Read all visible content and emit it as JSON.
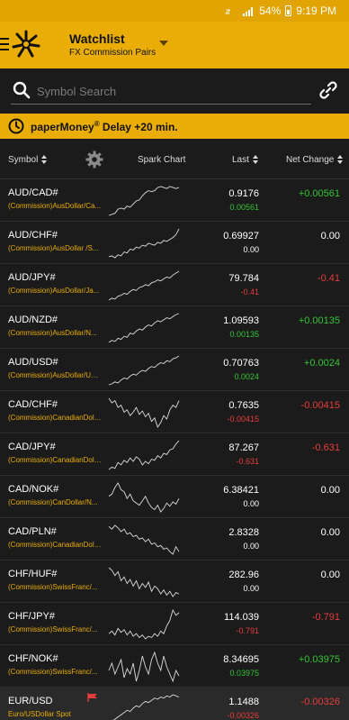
{
  "status_bar": {
    "battery": "54%",
    "time": "9:19 PM"
  },
  "header": {
    "title": "Watchlist",
    "subtitle": "FX Commission Pairs"
  },
  "search": {
    "placeholder": "Symbol Search"
  },
  "banner": {
    "brand": "paperMoney",
    "reg": "®",
    "text": " Delay +20 min."
  },
  "columns": {
    "symbol": "Symbol",
    "spark": "Spark Chart",
    "last": "Last",
    "net_change": "Net Change"
  },
  "colors": {
    "accent": "#e9ad06",
    "positive": "#35c435",
    "negative": "#e83c3c"
  },
  "rows": [
    {
      "symbol": "AUD/CAD#",
      "desc": "(Commission)AusDollar/Ca...",
      "last": "0.9176",
      "chg": "0.00561",
      "net": "+0.00561",
      "dir": "pos",
      "spark": [
        3,
        4,
        5,
        9,
        10,
        9,
        12,
        11,
        14,
        17,
        18,
        22,
        25,
        27,
        26,
        27,
        30,
        31,
        30,
        29,
        31,
        30,
        29,
        30
      ]
    },
    {
      "symbol": "AUD/CHF#",
      "desc": "(Commission)AusDollar /S...",
      "last": "0.69927",
      "chg": "0.00",
      "net": "0.00",
      "dir": "zero",
      "spark": [
        4,
        5,
        3,
        6,
        5,
        9,
        8,
        12,
        11,
        14,
        13,
        16,
        15,
        18,
        17,
        16,
        19,
        18,
        21,
        20,
        22,
        24,
        27,
        33
      ]
    },
    {
      "symbol": "AUD/JPY#",
      "desc": "(Commission)AusDollar/Ja...",
      "last": "79.784",
      "chg": "-0.41",
      "net": "-0.41",
      "dir": "neg",
      "spark": [
        3,
        5,
        4,
        7,
        8,
        10,
        9,
        12,
        14,
        13,
        16,
        17,
        19,
        18,
        21,
        22,
        24,
        23,
        25,
        27,
        26,
        29,
        31,
        33
      ]
    },
    {
      "symbol": "AUD/NZD#",
      "desc": "(Commission)AusDollar/N...",
      "last": "1.09593",
      "chg": "0.00135",
      "net": "+0.00135",
      "dir": "pos",
      "spark": [
        4,
        6,
        5,
        8,
        7,
        10,
        9,
        13,
        12,
        15,
        17,
        16,
        19,
        21,
        20,
        23,
        25,
        24,
        26,
        28,
        27,
        29,
        31,
        32
      ]
    },
    {
      "symbol": "AUD/USD#",
      "desc": "(Commission)AusDollar/US...",
      "last": "0.70763",
      "chg": "0.0024",
      "net": "+0.0024",
      "dir": "pos",
      "spark": [
        3,
        4,
        6,
        5,
        8,
        10,
        9,
        12,
        14,
        13,
        16,
        18,
        17,
        20,
        22,
        21,
        24,
        26,
        25,
        28,
        27,
        30,
        31,
        33
      ]
    },
    {
      "symbol": "CAD/CHF#",
      "desc": "(Commission)CanadianDoll...",
      "last": "0.7635",
      "chg": "-0.00415",
      "net": "-0.00415",
      "dir": "neg",
      "spark": [
        30,
        26,
        28,
        22,
        24,
        18,
        20,
        15,
        18,
        22,
        16,
        19,
        14,
        17,
        10,
        13,
        5,
        9,
        15,
        12,
        20,
        24,
        22,
        28
      ]
    },
    {
      "symbol": "CAD/JPY#",
      "desc": "(Commission)CanadianDoll...",
      "last": "87.267",
      "chg": "-0.631",
      "net": "-0.631",
      "dir": "neg",
      "spark": [
        8,
        10,
        9,
        14,
        12,
        16,
        14,
        18,
        15,
        19,
        17,
        12,
        15,
        13,
        17,
        16,
        20,
        18,
        22,
        21,
        25,
        26,
        30,
        33
      ]
    },
    {
      "symbol": "CAD/NOK#",
      "desc": "(Commission)CanDollar/N...",
      "last": "6.38421",
      "chg": "0.00",
      "net": "0.00",
      "dir": "zero",
      "spark": [
        20,
        22,
        28,
        32,
        26,
        24,
        18,
        22,
        16,
        14,
        12,
        16,
        20,
        14,
        10,
        8,
        12,
        6,
        9,
        14,
        11,
        15,
        13,
        18
      ]
    },
    {
      "symbol": "CAD/PLN#",
      "desc": "(Commission)CanadianDoll...",
      "last": "2.8328",
      "chg": "0.00",
      "net": "0.00",
      "dir": "zero",
      "spark": [
        26,
        24,
        27,
        25,
        22,
        24,
        20,
        21,
        18,
        19,
        16,
        17,
        14,
        16,
        12,
        13,
        10,
        11,
        8,
        9,
        6,
        4,
        10,
        6
      ]
    },
    {
      "symbol": "CHF/HUF#",
      "desc": "(Commission)SwissFranc/...",
      "last": "282.96",
      "chg": "0.00",
      "net": "0.00",
      "dir": "zero",
      "spark": [
        30,
        28,
        24,
        27,
        20,
        23,
        18,
        21,
        16,
        20,
        14,
        18,
        15,
        19,
        12,
        16,
        14,
        10,
        13,
        9,
        12,
        8,
        11,
        10
      ]
    },
    {
      "symbol": "CHF/JPY#",
      "desc": "(Commission)SwissFranc/...",
      "last": "114.039",
      "chg": "-0.791",
      "net": "-0.791",
      "dir": "neg",
      "spark": [
        10,
        12,
        9,
        14,
        11,
        13,
        9,
        12,
        8,
        10,
        7,
        9,
        6,
        8,
        7,
        10,
        8,
        12,
        10,
        16,
        20,
        28,
        24,
        26
      ]
    },
    {
      "symbol": "CHF/NOK#",
      "desc": "(Commission)SwissFranc/...",
      "last": "8.34695",
      "chg": "0.03975",
      "net": "+0.03975",
      "dir": "pos",
      "spark": [
        20,
        24,
        18,
        22,
        26,
        16,
        21,
        18,
        24,
        14,
        20,
        28,
        22,
        18,
        26,
        30,
        24,
        20,
        28,
        22,
        18,
        14,
        20,
        17
      ]
    },
    {
      "symbol": "EUR/USD",
      "desc": "Euro/USDollar Spot",
      "last": "1.1488",
      "chg": "-0.00326",
      "net": "-0.00326",
      "dir": "neg",
      "spark": [
        4,
        6,
        8,
        10,
        12,
        14,
        16,
        15,
        18,
        20,
        19,
        22,
        24,
        23,
        25,
        27,
        26,
        28,
        27,
        29,
        28,
        30,
        29,
        28
      ],
      "flag": true
    }
  ]
}
